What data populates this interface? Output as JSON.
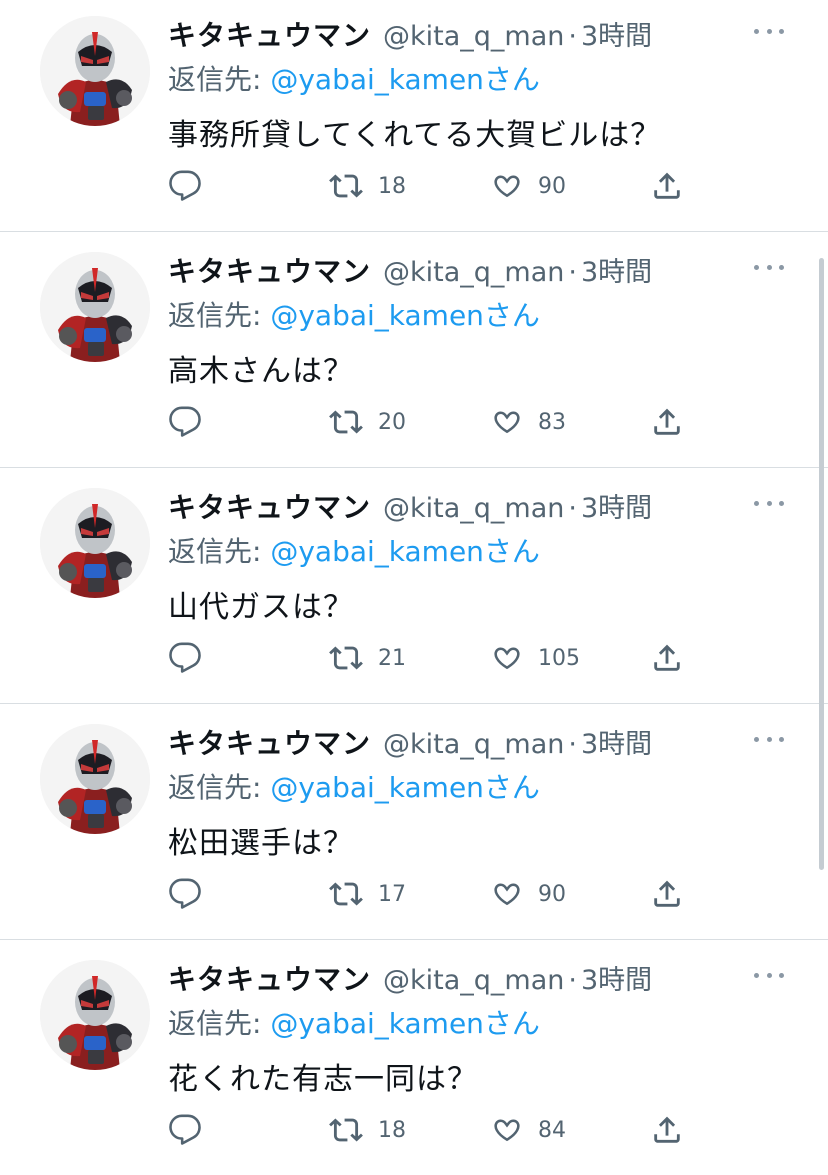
{
  "tweets": [
    {
      "name": "キタキュウマン",
      "handle": "@kita_q_man",
      "separator": "·",
      "time": "3時間",
      "reply_prefix": "返信先: ",
      "reply_mention": "@yabai_kamenさん",
      "text": "事務所貸してくれてる大賀ビルは？",
      "retweets": "18",
      "likes": "90"
    },
    {
      "name": "キタキュウマン",
      "handle": "@kita_q_man",
      "separator": "·",
      "time": "3時間",
      "reply_prefix": "返信先: ",
      "reply_mention": "@yabai_kamenさん",
      "text": "高木さんは？",
      "retweets": "20",
      "likes": "83"
    },
    {
      "name": "キタキュウマン",
      "handle": "@kita_q_man",
      "separator": "·",
      "time": "3時間",
      "reply_prefix": "返信先: ",
      "reply_mention": "@yabai_kamenさん",
      "text": "山代ガスは？",
      "retweets": "21",
      "likes": "105"
    },
    {
      "name": "キタキュウマン",
      "handle": "@kita_q_man",
      "separator": "·",
      "time": "3時間",
      "reply_prefix": "返信先: ",
      "reply_mention": "@yabai_kamenさん",
      "text": "松田選手は？",
      "retweets": "17",
      "likes": "90"
    },
    {
      "name": "キタキュウマン",
      "handle": "@kita_q_man",
      "separator": "·",
      "time": "3時間",
      "reply_prefix": "返信先: ",
      "reply_mention": "@yabai_kamenさん",
      "text": "花くれた有志一同は？",
      "retweets": "18",
      "likes": "84"
    }
  ],
  "icons": {
    "avatar": "hero-avatar",
    "more": "more-icon",
    "reply": "reply-icon",
    "retweet": "retweet-icon",
    "like": "heart-icon",
    "share": "share-icon"
  },
  "colors": {
    "text": "#0f1419",
    "secondary": "#536471",
    "link": "#1d9bf0",
    "divider": "#d9dee2"
  }
}
